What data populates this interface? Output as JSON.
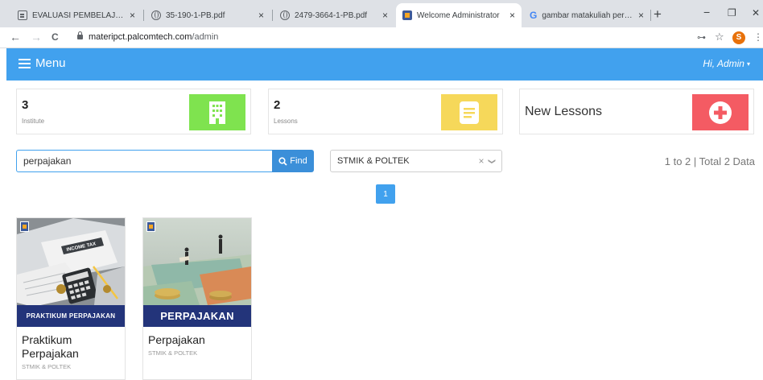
{
  "browser": {
    "tabs": [
      {
        "title": "EVALUASI PEMBELAJARAN MA",
        "close": "×"
      },
      {
        "title": "35-190-1-PB.pdf",
        "close": "×"
      },
      {
        "title": "2479-3664-1-PB.pdf",
        "close": "×"
      },
      {
        "title": "Welcome Administrator",
        "close": "×"
      },
      {
        "title": "gambar matakuliah perpajaka",
        "close": "×"
      }
    ],
    "new_tab": "+",
    "window": {
      "minimize": "−",
      "restore": "❐",
      "close": "✕"
    },
    "url_host": "materipct.palcomtech.com",
    "url_path": "/admin",
    "profile_initial": "S",
    "icons": {
      "back": "←",
      "forward": "→",
      "reload": "C",
      "key": "⊶",
      "star": "☆",
      "kebab": "⋮"
    }
  },
  "navbar": {
    "menu_label": "Menu",
    "user_greeting": "Hi, Admin",
    "caret": "▾"
  },
  "stats": {
    "institute": {
      "count": "3",
      "label": "Institute",
      "color": "#7fe34f"
    },
    "lessons": {
      "count": "2",
      "label": "Lessons",
      "color": "#f6d85a"
    },
    "new_lessons": {
      "label": "New Lessons",
      "color": "#f45b63"
    }
  },
  "search": {
    "value": "perpajakan",
    "find_label": "Find",
    "find_icon": "🔍"
  },
  "filter": {
    "selected": "STMIK & POLTEK",
    "clear": "×",
    "chevron": "❯"
  },
  "pagination": {
    "summary": "1 to 2 | Total 2 Data",
    "current_page": "1"
  },
  "lessons": [
    {
      "banner": "PRAKTIKUM PERPAJAKAN",
      "title": "Praktikum Perpajakan",
      "institute": "STMIK & POLTEK",
      "thumb_text": "INCOME TAX"
    },
    {
      "banner": "PERPAJAKAN",
      "title": "Perpajakan",
      "institute": "STMIK & POLTEK"
    }
  ],
  "colors": {
    "accent": "#41a1ee",
    "banner": "#23347a"
  }
}
